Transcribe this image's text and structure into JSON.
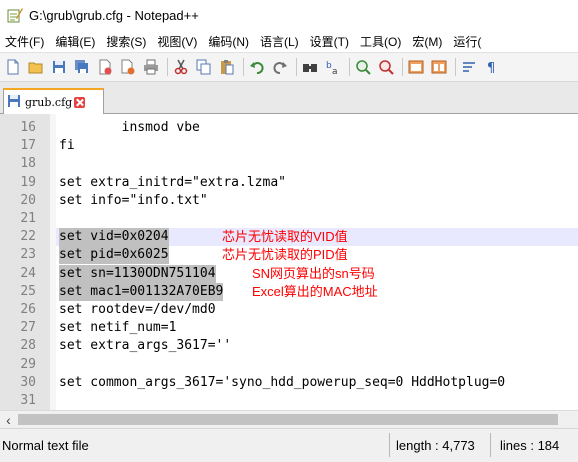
{
  "window": {
    "title": "G:\\grub\\grub.cfg - Notepad++"
  },
  "menu": {
    "items": [
      "文件(F)",
      "编辑(E)",
      "搜索(S)",
      "视图(V)",
      "编码(N)",
      "语言(L)",
      "设置(T)",
      "工具(O)",
      "宏(M)",
      "运行("
    ]
  },
  "toolbar": {
    "icons": [
      "new-file-icon",
      "open-file-icon",
      "save-icon",
      "save-all-icon",
      "close-icon",
      "close-all-icon",
      "print-icon",
      "cut-icon",
      "copy-icon",
      "paste-icon",
      "undo-icon",
      "redo-icon",
      "find-icon",
      "replace-icon",
      "zoom-in-icon",
      "zoom-out-icon",
      "sync-vertical-icon",
      "sync-horizontal-icon",
      "word-wrap-icon",
      "show-all-chars-icon"
    ]
  },
  "tab": {
    "label": "grub.cfg"
  },
  "editor": {
    "lines": [
      {
        "num": "16",
        "text": "        insmod vbe"
      },
      {
        "num": "17",
        "text": "fi"
      },
      {
        "num": "18",
        "text": ""
      },
      {
        "num": "19",
        "text": "set extra_initrd=\"extra.lzma\""
      },
      {
        "num": "20",
        "text": "set info=\"info.txt\""
      },
      {
        "num": "21",
        "text": ""
      },
      {
        "num": "22",
        "text": "set vid=0x0204"
      },
      {
        "num": "23",
        "text": "set pid=0x6025"
      },
      {
        "num": "24",
        "text": "set sn=1130ODN751104"
      },
      {
        "num": "25",
        "text": "set mac1=001132A70EB9"
      },
      {
        "num": "26",
        "text": "set rootdev=/dev/md0"
      },
      {
        "num": "27",
        "text": "set netif_num=1"
      },
      {
        "num": "28",
        "text": "set extra_args_3617=''"
      },
      {
        "num": "29",
        "text": ""
      },
      {
        "num": "30",
        "text": "set common_args_3617='syno_hdd_powerup_seq=0 HddHotplug=0"
      },
      {
        "num": "31",
        "text": ""
      }
    ],
    "annotations": {
      "vid": "芯片无忧读取的VID值",
      "pid": "芯片无忧读取的PID值",
      "sn": "SN网页算出的sn号码",
      "mac": "Excel算出的MAC地址"
    },
    "annotation_color": "#ff0000"
  },
  "status": {
    "file_type": "Normal text file",
    "length": "length : 4,773",
    "lines": "lines : 184"
  }
}
